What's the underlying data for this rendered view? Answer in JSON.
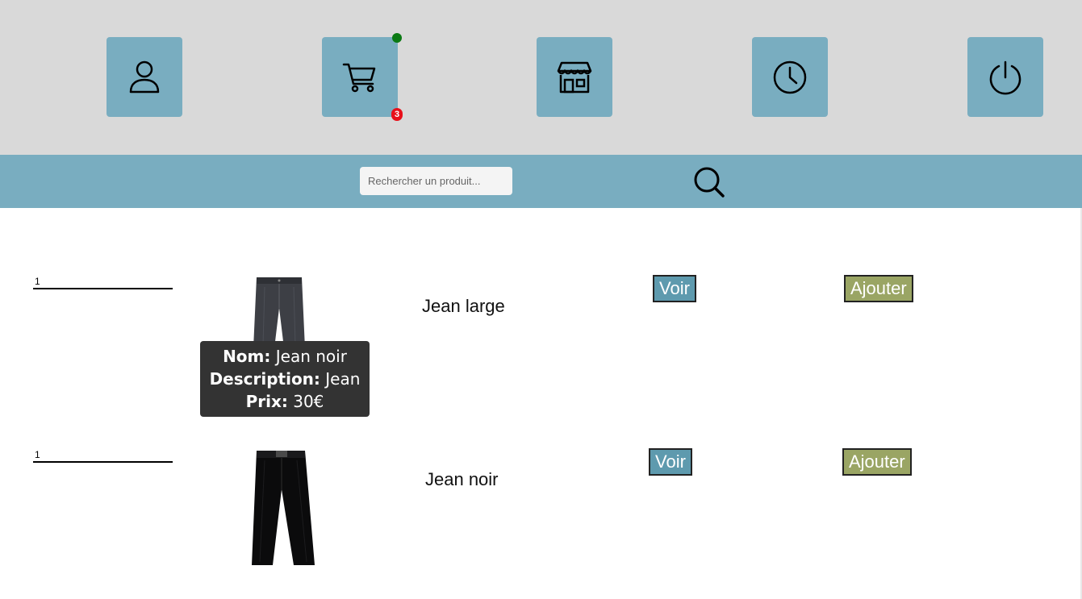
{
  "nav": {
    "items": [
      {
        "name": "profile",
        "icon": "user-icon"
      },
      {
        "name": "cart",
        "icon": "cart-icon",
        "badge": "3",
        "status_color": "#0b7a14",
        "badge_color": "#e8101a"
      },
      {
        "name": "shop",
        "icon": "store-icon"
      },
      {
        "name": "history",
        "icon": "clock-icon"
      },
      {
        "name": "logout",
        "icon": "power-icon"
      }
    ],
    "tile_color": "#79adc0",
    "background": "#d9d9d9"
  },
  "search": {
    "placeholder": "Rechercher un produit...",
    "value": "",
    "icon": "search-icon"
  },
  "products": [
    {
      "quantity": "1",
      "name": "Jean large",
      "view_label": "Voir",
      "add_label": "Ajouter",
      "image": "grey-jeans"
    },
    {
      "quantity": "1",
      "name": "Jean noir",
      "view_label": "Voir",
      "add_label": "Ajouter",
      "image": "black-jeans"
    }
  ],
  "tooltip": {
    "name_label": "Nom:",
    "name_value": " Jean noir",
    "description_label": "Description:",
    "description_value": " Jean",
    "price_label": "Prix:",
    "price_value": " 30€"
  },
  "colors": {
    "voir_button": "#5e9aae",
    "ajouter_button": "#9aa564",
    "tooltip_bg": "#333333"
  }
}
